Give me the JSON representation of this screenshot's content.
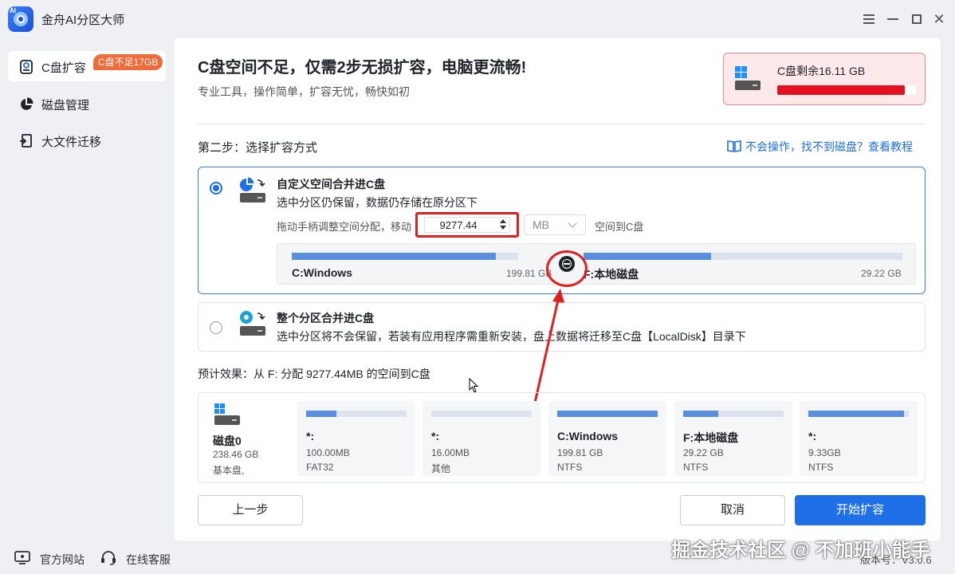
{
  "app": {
    "title": "金舟AI分区大师",
    "logo_tag": "AI"
  },
  "sidebar": {
    "items": [
      {
        "label": "C盘扩容",
        "badge": "C盘不足17GB",
        "icon": "disk-expand-icon"
      },
      {
        "label": "磁盘管理",
        "icon": "pie-chart-icon"
      },
      {
        "label": "大文件迁移",
        "icon": "file-migrate-icon"
      }
    ]
  },
  "footer": {
    "website": "官方网站",
    "support": "在线客服",
    "version": "版本号：V3.0.6",
    "watermark": "掘金技术社区 @ 不加班小能手"
  },
  "main": {
    "headline": "C盘空间不足，仅需2步无损扩容，电脑更流畅!",
    "subline": "专业工具，操作简单，扩容无忧，畅快如初",
    "space_card": {
      "label": "C盘剩余16.11 GB",
      "used_fraction": 0.92,
      "bar_color": "#e5101d"
    },
    "step_label": "第二步：选择扩容方式",
    "help_link": "不会操作，找不到磁盘？查看教程",
    "option1": {
      "title": "自定义空间合并进C盘",
      "desc": "选中分区仍保留，数据仍存储在原分区下",
      "adjust_prefix": "拖动手柄调整空间分配，移动",
      "amount": "9277.44",
      "unit": "MB",
      "adjust_suffix": "空间到C盘",
      "partitions": [
        {
          "name": "C:Windows",
          "size": "199.81 GB",
          "used_fraction": 0.9
        },
        {
          "name": "F:本地磁盘",
          "size": "29.22 GB",
          "used_fraction": 0.4
        }
      ]
    },
    "option2": {
      "title": "整个分区合并进C盘",
      "desc": "选中分区将不会保留，若装有应用程序需重新安装，盘上数据将迁移至C盘【LocalDisk】目录下"
    },
    "forecast": "预计效果：从 F: 分配 9277.44MB 的空间到C盘",
    "disk": {
      "name": "磁盘0",
      "size": "238.46 GB",
      "type": "基本盘,",
      "partitions": [
        {
          "name": "*:",
          "size": "100.00MB",
          "fs": "FAT32",
          "used_fraction": 0.3
        },
        {
          "name": "*:",
          "size": "16.00MB",
          "fs": "其他",
          "used_fraction": 0.0
        },
        {
          "name": "C:Windows",
          "size": "199.81 GB",
          "fs": "NTFS",
          "used_fraction": 1.0
        },
        {
          "name": "F:本地磁盘",
          "size": "29.22 GB",
          "fs": "NTFS",
          "used_fraction": 0.35
        },
        {
          "name": "*:",
          "size": "9.33GB",
          "fs": "NTFS",
          "used_fraction": 0.95
        }
      ]
    },
    "buttons": {
      "back": "上一步",
      "cancel": "取消",
      "start": "开始扩容"
    }
  },
  "colors": {
    "accent": "#1e6fe8",
    "warning": "#e5101d",
    "badge": "#f06a3a",
    "annotation": "#e02020"
  }
}
